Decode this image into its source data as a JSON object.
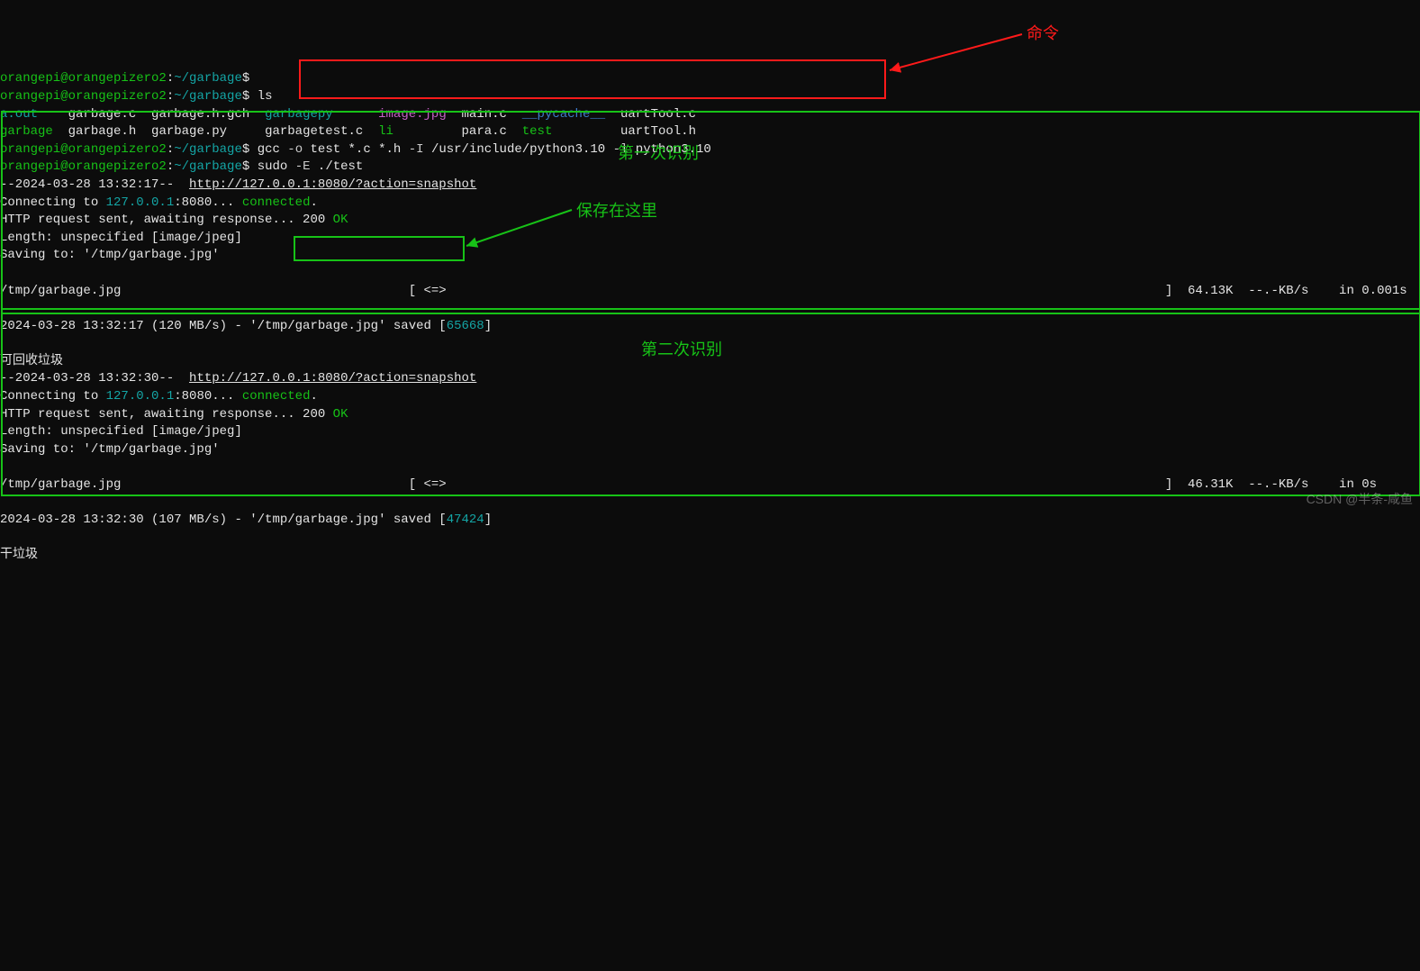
{
  "lines": {
    "l0a": "orangepi@orangepizero2",
    "l0b": ":",
    "l0c": "~/garbage",
    "l0d": "$",
    "l1a": "orangepi@orangepizero2",
    "l1b": ":",
    "l1c": "~/garbage",
    "l1d": "$ ",
    "l1e": "ls",
    "ls_row1": {
      "a": "a.out",
      "b": "garbage.c",
      "c": "garbage.h.gch",
      "d": "garbagepy",
      "e": "image.jpg",
      "f": "main.c",
      "g": "__pycache__",
      "h": "uartTool.c"
    },
    "ls_row2": {
      "a": "garbage",
      "b": "garbage.h",
      "c": "garbage.py",
      "d": "garbagetest.c",
      "e": "li",
      "f": "para.c",
      "g": "test",
      "h": "uartTool.h"
    },
    "cmd1_prompt_user": "orangepi@orangepizero2",
    "cmd1_prompt_path": "~/garbage",
    "cmd1_dollar": "$ ",
    "cmd1_p0": "gcc ",
    "cmd1_p1": "-o",
    "cmd1_p2": " test *.c *.h ",
    "cmd1_p3": "-I",
    "cmd1_p4": " /usr/include/python3.10 ",
    "cmd1_p5": "-l",
    "cmd1_p6": " python3.10",
    "cmd2_prompt_user": "orangepi@orangepizero2",
    "cmd2_prompt_path": "~/garbage",
    "cmd2_dollar": "$ ",
    "cmd2_p0": "sudo ",
    "cmd2_p1": "-E",
    "cmd2_p2": " ./test",
    "ts1": "--2024-03-28 13:32:17--  ",
    "url1": "http://127.0.0.1:8080/?action=snapshot",
    "conn_a": "Connecting to ",
    "conn_ip": "127.0.0.1",
    "conn_b": ":8080... ",
    "conn_ok": "connected",
    "conn_dot": ".",
    "http_a": "HTTP request sent, awaiting response... 200 ",
    "http_ok": "OK",
    "len": "Length: unspecified [image/jpeg]",
    "sav": "Saving to: '/tmp/garbage.jpg'",
    "prog1_a": "/tmp/garbage.jpg",
    "prog1_b": "[ <=>",
    "prog1_c": "]  64.13K  --.-KB/s    in 0.001s",
    "done1_a": "2024-03-28 13:32:17 (120 MB/s) - ",
    "done1_b": "'/tmp/garbage.jpg'",
    "done1_c": " saved ",
    "done1_d": "[",
    "done1_e": "65668",
    "done1_f": "]",
    "cat1": "可回收垃圾",
    "ts2": "--2024-03-28 13:32:30--  ",
    "url2": "http://127.0.0.1:8080/?action=snapshot",
    "prog2_a": "/tmp/garbage.jpg",
    "prog2_b": "[ <=>",
    "prog2_c": "]  46.31K  --.-KB/s    in 0s",
    "done2_a": "2024-03-28 13:32:30 (107 MB/s) - '/tmp/garbage.jpg' saved ",
    "done2_b": "[",
    "done2_c": "47424",
    "done2_d": "]",
    "cat2": "干垃圾"
  },
  "annotations": {
    "a_cmd": "命令",
    "a_first": "第一次识别",
    "a_save": "保存在这里",
    "a_second": "第二次识别"
  },
  "watermark": "CSDN @半条-咸鱼"
}
